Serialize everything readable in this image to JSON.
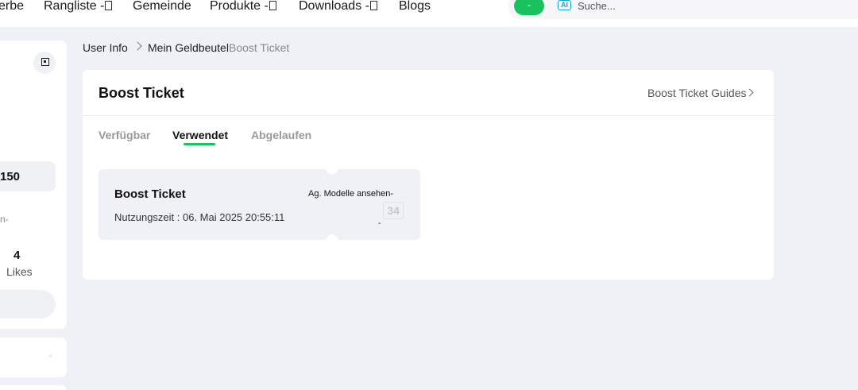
{
  "nav": {
    "items": [
      {
        "label": "erbe"
      },
      {
        "label": "Rangliste -"
      },
      {
        "label": "Gemeinde"
      },
      {
        "label": "Produkte -"
      },
      {
        "label": "Downloads -"
      },
      {
        "label": "Blogs"
      }
    ],
    "pill_label": "-",
    "ai_label": "AI",
    "search_placeholder": "Suche..."
  },
  "sidebar": {
    "stat_value": "150",
    "dash_text": "n-",
    "likes_count": "4",
    "likes_label": "Likes",
    "card2_dash": "-"
  },
  "breadcrumb": {
    "item1": "User Info",
    "item2": "Mein Geldbeutel",
    "item3": "Boost Ticket"
  },
  "panel": {
    "title": "Boost Ticket",
    "guides_link": "Boost Ticket Guides",
    "tabs": [
      {
        "label": "Verfügbar"
      },
      {
        "label": "Verwendet"
      },
      {
        "label": "Abgelaufen"
      }
    ]
  },
  "ticket": {
    "title": "Boost Ticket",
    "usage_time": "Nutzungszeit : 06. Mai 2025 20:55:11",
    "action": "Ag. Modelle ansehen-",
    "stamp": "34",
    "dash": "-"
  },
  "colors": {
    "accent": "#19c15f",
    "background": "#f0f1f6"
  }
}
